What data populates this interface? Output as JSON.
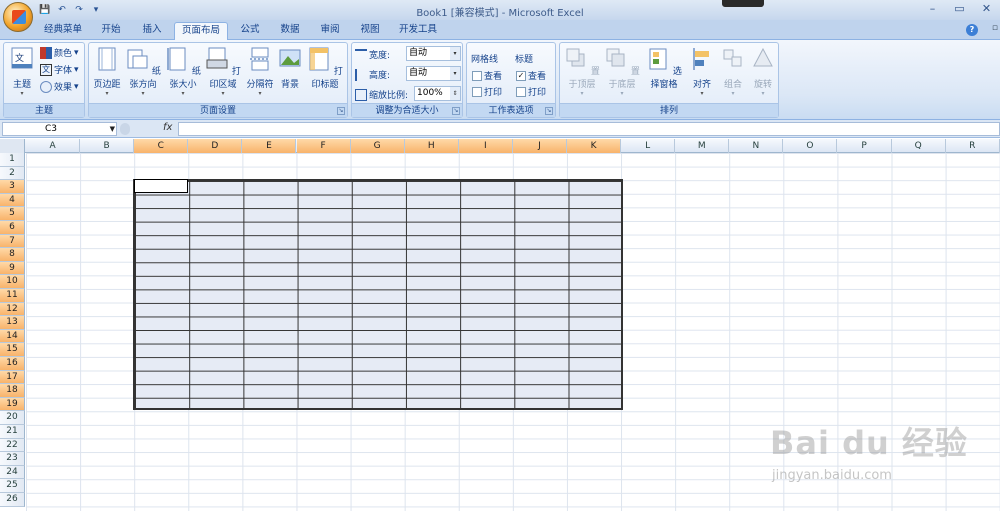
{
  "window": {
    "title": "Book1 [兼容模式] - Microsoft Excel"
  },
  "tabs": [
    "经典菜单",
    "开始",
    "插入",
    "页面布局",
    "公式",
    "数据",
    "审阅",
    "视图",
    "开发工具"
  ],
  "active_tab": "页面布局",
  "ribbon": {
    "theme_group": {
      "label": "主题",
      "theme_button": "主题",
      "colors": "颜色",
      "fonts": "字体",
      "effects": "效果"
    },
    "page_setup_group": {
      "label": "页面设置",
      "margins": "页边距",
      "orientation": "纸张方向",
      "size": "纸张大小",
      "print_area": "打印区域",
      "breaks": "分隔符",
      "background": "背景",
      "print_titles": "打印标题"
    },
    "scale_group": {
      "label": "调整为合适大小",
      "width_label": "宽度:",
      "width_value": "自动",
      "height_label": "高度:",
      "height_value": "自动",
      "scale_label": "缩放比例:",
      "scale_value": "100%"
    },
    "sheet_options_group": {
      "label": "工作表选项",
      "gridlines": "网格线",
      "headings": "标题",
      "view": "查看",
      "print": "打印",
      "gridlines_view_checked": false,
      "gridlines_print_checked": false,
      "headings_view_checked": true,
      "headings_print_checked": false
    },
    "arrange_group": {
      "label": "排列",
      "bring_front": "置于顶层",
      "send_back": "置于底层",
      "selection_pane": "选择窗格",
      "align": "对齐",
      "group": "组合",
      "rotate": "旋转"
    }
  },
  "formula_bar": {
    "name_box": "C3",
    "fx": "fx",
    "formula": ""
  },
  "grid": {
    "columns": [
      "A",
      "B",
      "C",
      "D",
      "E",
      "F",
      "G",
      "H",
      "I",
      "J",
      "K",
      "L",
      "M",
      "N",
      "O",
      "P",
      "Q",
      "R"
    ],
    "selected_columns": [
      "C",
      "D",
      "E",
      "F",
      "G",
      "H",
      "I",
      "J",
      "K"
    ],
    "rows": [
      "1",
      "2",
      "3",
      "4",
      "5",
      "6",
      "7",
      "8",
      "9",
      "10",
      "11",
      "12",
      "13",
      "14",
      "15",
      "16",
      "17",
      "18",
      "19",
      "20",
      "21",
      "22",
      "23",
      "24",
      "25",
      "26"
    ],
    "selected_rows": [
      "3",
      "4",
      "5",
      "6",
      "7",
      "8",
      "9",
      "10",
      "11",
      "12",
      "13",
      "14",
      "15",
      "16",
      "17",
      "18",
      "19"
    ],
    "active_cell": "C3",
    "selection": "C3:K19"
  },
  "watermark": {
    "text": "Bai du 经验",
    "sub": "jingyan.baidu.com"
  },
  "colors": {
    "accent": "#15428b",
    "selection_header": "#f8b36b",
    "selection_fill": "#e6ebf5"
  }
}
